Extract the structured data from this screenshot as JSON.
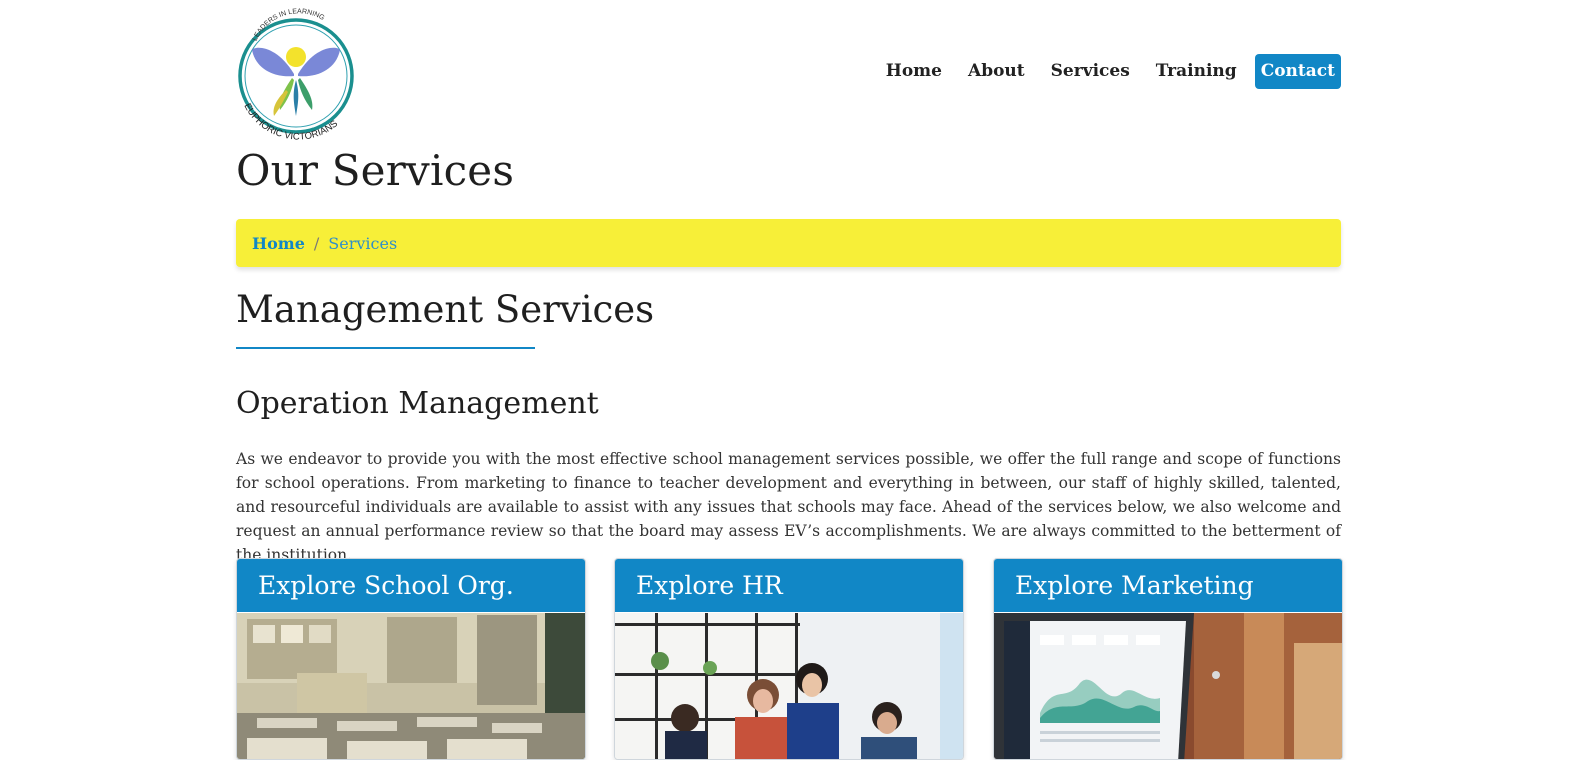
{
  "header": {
    "logo": {
      "top_text": "LEADERS IN LEARNING",
      "bottom_text": "EUPHORIC VICTORIANS"
    },
    "nav": {
      "home": "Home",
      "about": "About",
      "services": "Services",
      "training": "Training",
      "contact": "Contact"
    }
  },
  "page_title": "Our Services",
  "breadcrumb": {
    "home": "Home",
    "separator": "/",
    "current": "Services"
  },
  "section_title": "Management Services",
  "sub_title": "Operation Management",
  "intro": "As we endeavor to provide you with the most effective school management services possible, we offer the full range and scope of functions for school operations. From marketing to finance to teacher development and everything in between, our staff of highly skilled, talented, and resourceful individuals are available to assist with any issues that schools may face. Ahead of the services below, we also welcome and request an annual performance review so that the board may assess EV’s accomplishments. We are always committed to the betterment of the institution.",
  "cards": [
    {
      "title": "Explore School Org.",
      "image": "classroom-photo"
    },
    {
      "title": "Explore HR",
      "image": "team-photo"
    },
    {
      "title": "Explore Marketing",
      "image": "laptop-dashboard-photo"
    }
  ],
  "colors": {
    "brand_blue": "#1187c6",
    "breadcrumb_yellow": "#f7ef38"
  }
}
